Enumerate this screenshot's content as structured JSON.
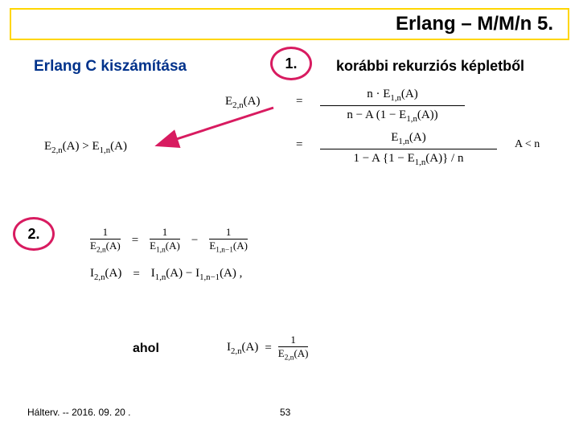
{
  "title": "Erlang – M/M/n  5.",
  "subtitle": "Erlang C kiszámítása",
  "marker1": "1.",
  "marker2": "2.",
  "from_text": "korábbi rekurziós képletből",
  "eq": {
    "e2a": "E₂,ₙ(A)",
    "eq_sign": "=",
    "frac1_num": "n · E₁,ₙ(A)",
    "frac1_den": "n − A (1 − E₁,ₙ(A))",
    "frac2_num": "E₁,ₙ(A)",
    "frac2_den": "1 − A {1 − E₁,ₙ(A)} / n",
    "cond": "A < n",
    "ineq": "E₂,ₙ(A) > E₁,ₙ(A)"
  },
  "block2": {
    "l1_lhs_n": "1",
    "l1_lhs_d": "E₂,ₙ(A)",
    "l1_eq": "=",
    "l1_r1_n": "1",
    "l1_r1_d": "E₁,ₙ(A)",
    "l1_minus": "−",
    "l1_r2_n": "1",
    "l1_r2_d": "E₁,ₙ₋₁(A)",
    "l2_lhs": "I₂,ₙ(A)",
    "l2_eq": "=",
    "l2_rhs": "I₁,ₙ(A) − I₁,ₙ₋₁(A) ,"
  },
  "ahol_label": "ahol",
  "ahol_eq": {
    "lhs": "I₂,ₙ(A)",
    "eq": "=",
    "num": "1",
    "den": "E₂,ₙ(A)"
  },
  "footer_left": "Hálterv. -- 2016. 09. 20 .",
  "footer_page": "53"
}
